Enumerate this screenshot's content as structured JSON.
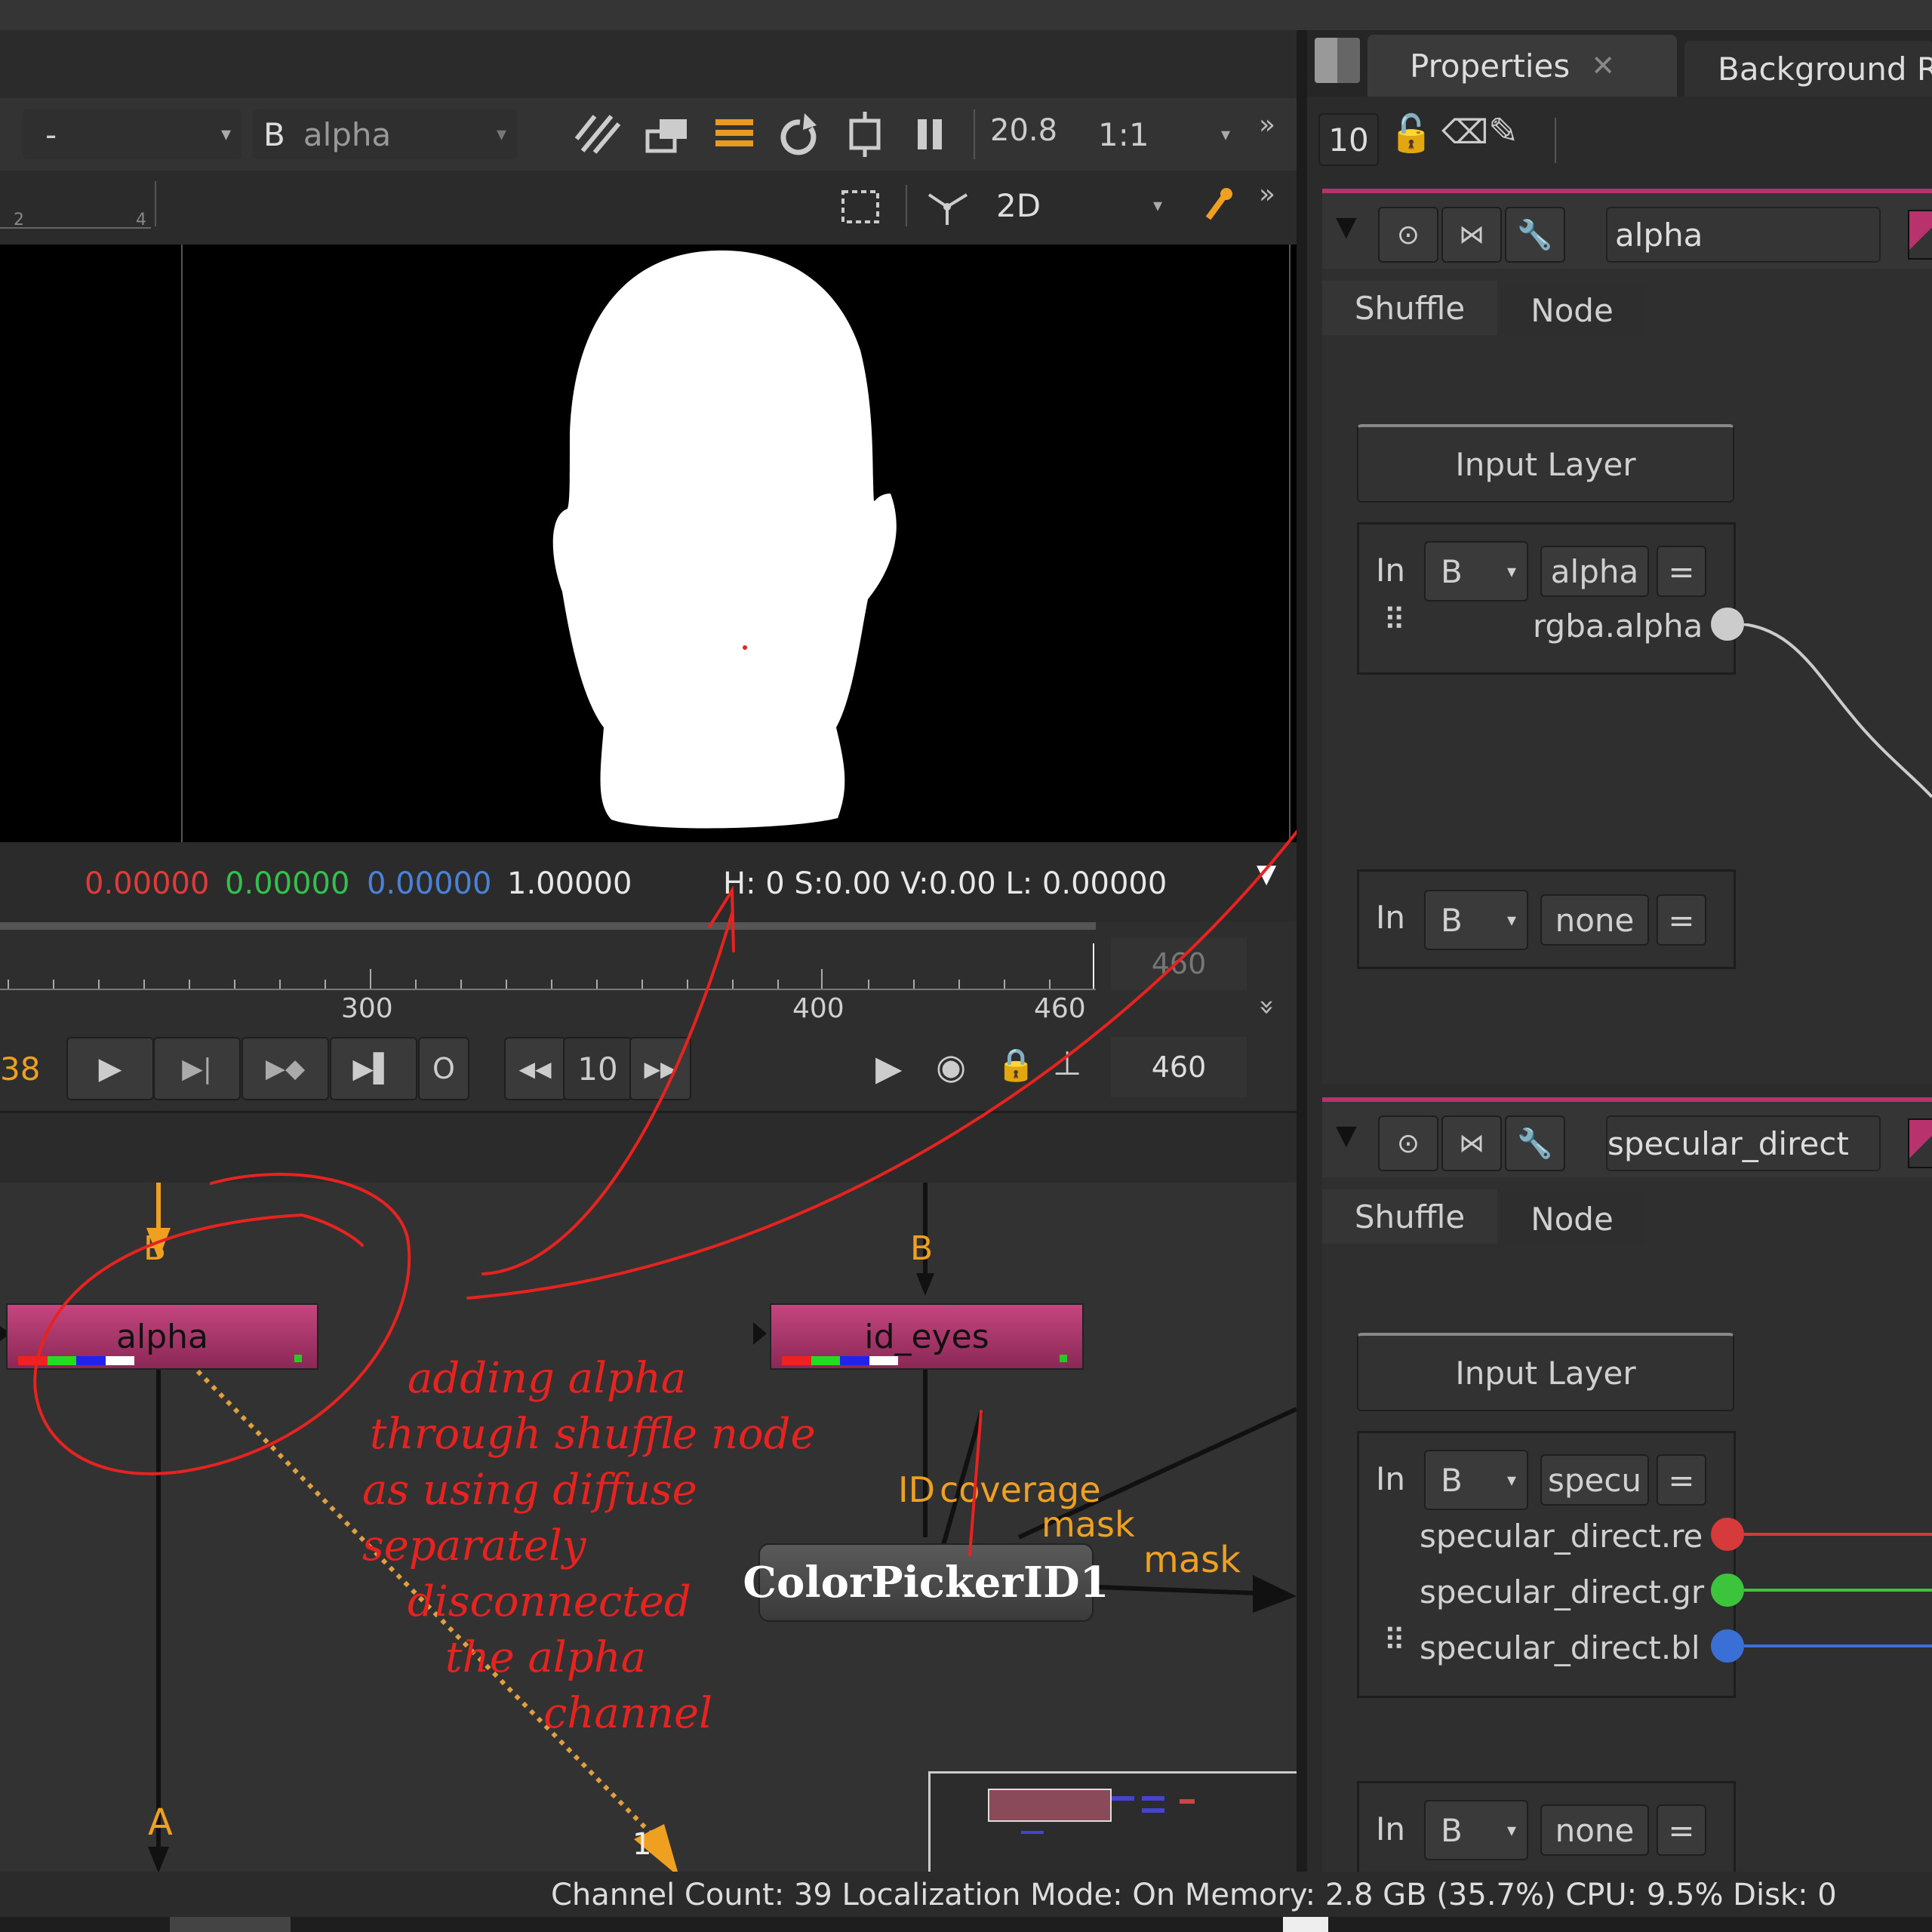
{
  "viewer": {
    "dropdown_a": "-",
    "b_label": "B",
    "b_channel": "alpha",
    "gain": "20.8",
    "zoom": "1:1",
    "mode": "2D",
    "ruler_left": "2",
    "ruler_right": "4",
    "pixel": {
      "r": "0.00000",
      "g": "0.00000",
      "b": "0.00000",
      "a": "1.00000",
      "hsvl": "H:  0 S:0.00 V:0.00  L: 0.00000"
    }
  },
  "timeline": {
    "ticks": [
      "300",
      "400",
      "460"
    ],
    "end_frame": "460",
    "current_frame_partial": "38",
    "frame_increment": "10",
    "out_frame": "460"
  },
  "nodegraph": {
    "node_alpha": "alpha",
    "node_eyes": "id_eyes",
    "node_picker": "ColorPickerID1",
    "input_b_left": "B",
    "input_b_right": "B",
    "label_a": "A",
    "label_1": "1",
    "label_id": "ID",
    "label_coverage": "coverage",
    "label_mask1": "mask",
    "label_mask2": "mask"
  },
  "annotation": {
    "line1": "adding alpha",
    "line2": "through shuffle node",
    "line3": "as using diffuse separately",
    "line4": "disconnected",
    "line5": "the alpha",
    "line6": "channel"
  },
  "properties": {
    "tab_active": "Properties",
    "tab_other": "Background Re",
    "max_panels": "10",
    "panel1": {
      "name": "alpha",
      "tab_shuffle": "Shuffle",
      "tab_node": "Node",
      "input_layer": "Input Layer",
      "in1_label": "In",
      "in1_stream": "B",
      "in1_layer": "alpha",
      "eq": "=",
      "channels": [
        "rgba.alpha"
      ],
      "in2_label": "In",
      "in2_stream": "B",
      "in2_layer": "none"
    },
    "panel2": {
      "name": "specular_direct",
      "tab_shuffle": "Shuffle",
      "tab_node": "Node",
      "input_layer": "Input Layer",
      "in1_label": "In",
      "in1_stream": "B",
      "in1_layer": "specu",
      "eq": "=",
      "channels": [
        "specular_direct.re",
        "specular_direct.gr",
        "specular_direct.bl"
      ],
      "in2_label": "In",
      "in2_stream": "B",
      "in2_layer": "none"
    }
  },
  "status": {
    "text": "Channel Count: 39  Localization Mode: On  Memory: 2.8 GB (35.7%)  CPU: 9.5%  Disk: 0"
  },
  "colors": {
    "node_pink": "#a8366b",
    "accent_orange": "#f0a020",
    "annotation_red": "#e8231f",
    "chan_red": "#d63a3a",
    "chan_green": "#3cc43c",
    "chan_blue": "#3a6fd6"
  }
}
